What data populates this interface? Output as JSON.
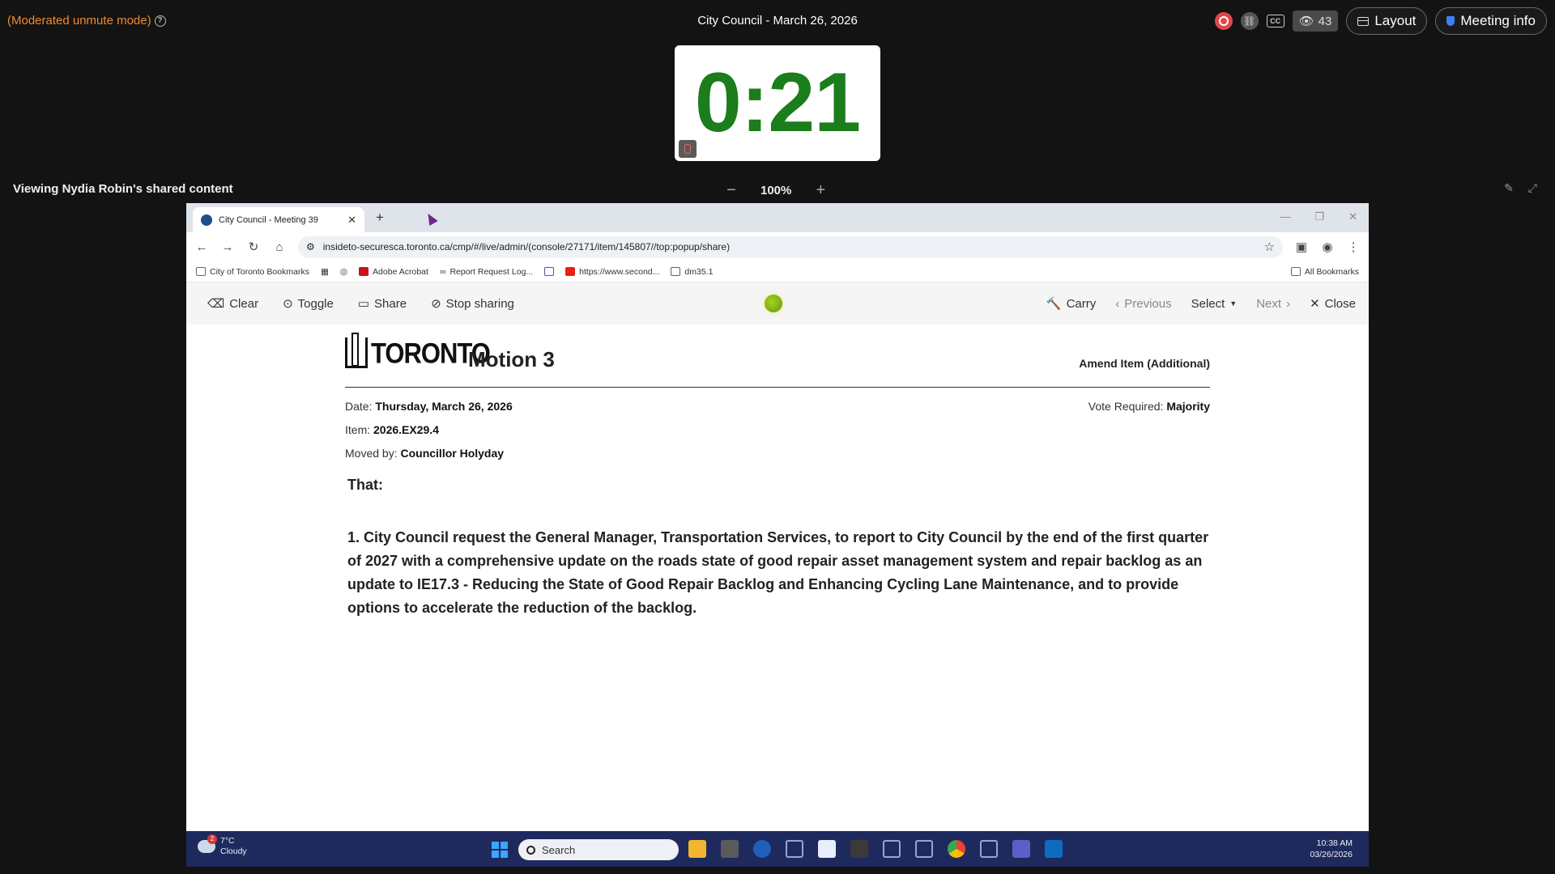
{
  "meeting": {
    "moderation_label": "(Moderated unmute mode)",
    "title": "City Council - March 26, 2026",
    "participant_count": "43",
    "layout_label": "Layout",
    "meeting_info_label": "Meeting info",
    "cc_label": "CC"
  },
  "timer": {
    "value": "0:21"
  },
  "viewing": {
    "label": "Viewing Nydia Robin's shared content",
    "zoom": "100%",
    "zoom_minus": "−",
    "zoom_plus": "+"
  },
  "browser": {
    "tab_title": "City Council - Meeting 39",
    "url": "insideto-securesca.toronto.ca/cmp/#/live/admin/(console/27171/item/145807//top:popup/share)",
    "bookmarks": [
      "City of Toronto Bookmarks",
      "Adobe Acrobat",
      "Report Request Log...",
      "https://www.second...",
      "dm35.1"
    ],
    "all_bookmarks": "All Bookmarks"
  },
  "toolbar": {
    "clear": "Clear",
    "toggle": "Toggle",
    "share": "Share",
    "stop_sharing": "Stop sharing",
    "carry": "Carry",
    "previous": "Previous",
    "select": "Select",
    "next": "Next",
    "close": "Close"
  },
  "motion": {
    "logo_text": "TORONTO",
    "title": "Motion 3",
    "type": "Amend Item (Additional)",
    "date_label": "Date:",
    "date_value": "Thursday, March 26, 2026",
    "vote_label": "Vote Required:",
    "vote_value": "Majority",
    "item_label": "Item:",
    "item_value": "2026.EX29.4",
    "moved_label": "Moved by:",
    "moved_value": "Councillor Holyday",
    "that": "That:",
    "body": "1. City Council request the General Manager, Transportation Services, to report to City Council by the end of the first quarter of 2027 with a comprehensive update on the roads state of good repair asset management system and repair backlog as an update to IE17.3 - Reducing the State of Good Repair Backlog and Enhancing Cycling Lane Maintenance, and to provide options to accelerate the reduction of the backlog."
  },
  "taskbar": {
    "weather_badge": "2",
    "temperature": "7°C",
    "condition": "Cloudy",
    "search_placeholder": "Search",
    "time": "10:38 AM",
    "date": "03/26/2026"
  },
  "colors": {
    "timer_green": "#1b7d1b",
    "moderation_orange": "#f08a2e",
    "recording_red": "#e04848",
    "taskbar": "#1e2a5e"
  }
}
